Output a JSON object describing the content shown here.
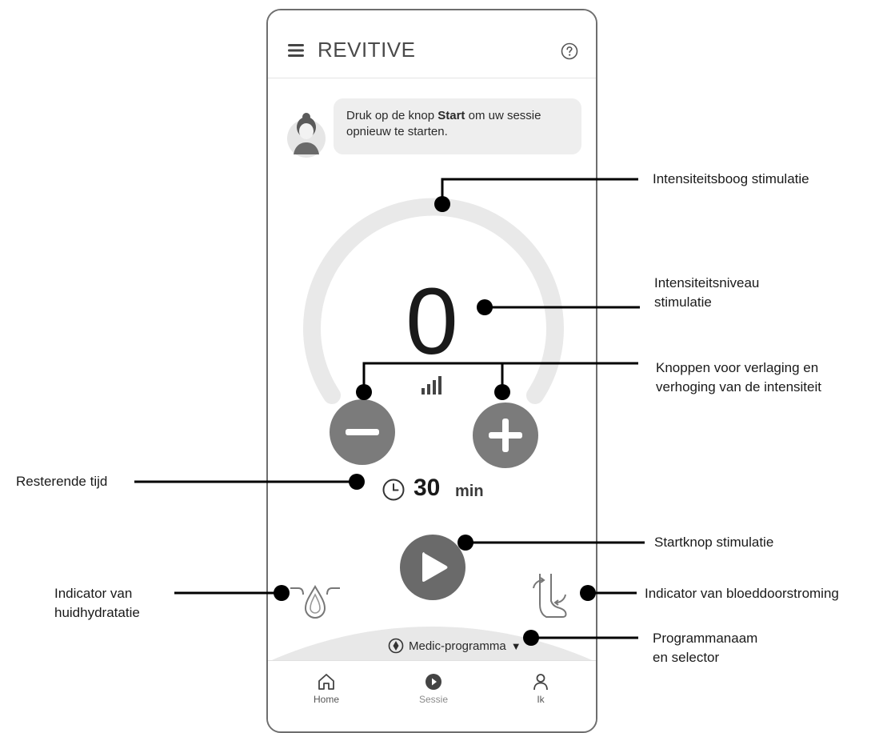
{
  "app": {
    "brand": "REVITIVE",
    "coach_message_pre": "Druk op de knop ",
    "coach_message_bold": "Start",
    "coach_message_post": " om uw sessie opnieuw te starten.",
    "intensity_level": "0",
    "intensity_fraction": 0,
    "time_value": "30",
    "time_unit": "min",
    "program_name": "Medic-programma",
    "nav": [
      {
        "label": "Home",
        "icon": "home-icon"
      },
      {
        "label": "Sessie",
        "icon": "play-circle-icon"
      },
      {
        "label": "Ik",
        "icon": "person-icon"
      }
    ]
  },
  "callouts": {
    "arc": "Intensiteitsboog stimulatie",
    "level_line1": "Intensiteitsniveau",
    "level_line2": "stimulatie",
    "buttons_line1": "Knoppen voor verlaging en",
    "buttons_line2": "verhoging van de intensiteit",
    "time": "Resterende tijd",
    "start": "Startknop stimulatie",
    "hydration_line1": "Indicator van",
    "hydration_line2": "huidhydratatie",
    "flow": "Indicator van bloeddoorstroming",
    "program_line1": "Programmanaam",
    "program_line2": "en selector"
  },
  "colors": {
    "frame": "#6e6e6e",
    "arc": "#e9e9e9",
    "button": "#7b7b7b",
    "start_button": "#6a6a6a",
    "bubble": "#eeeeee"
  }
}
